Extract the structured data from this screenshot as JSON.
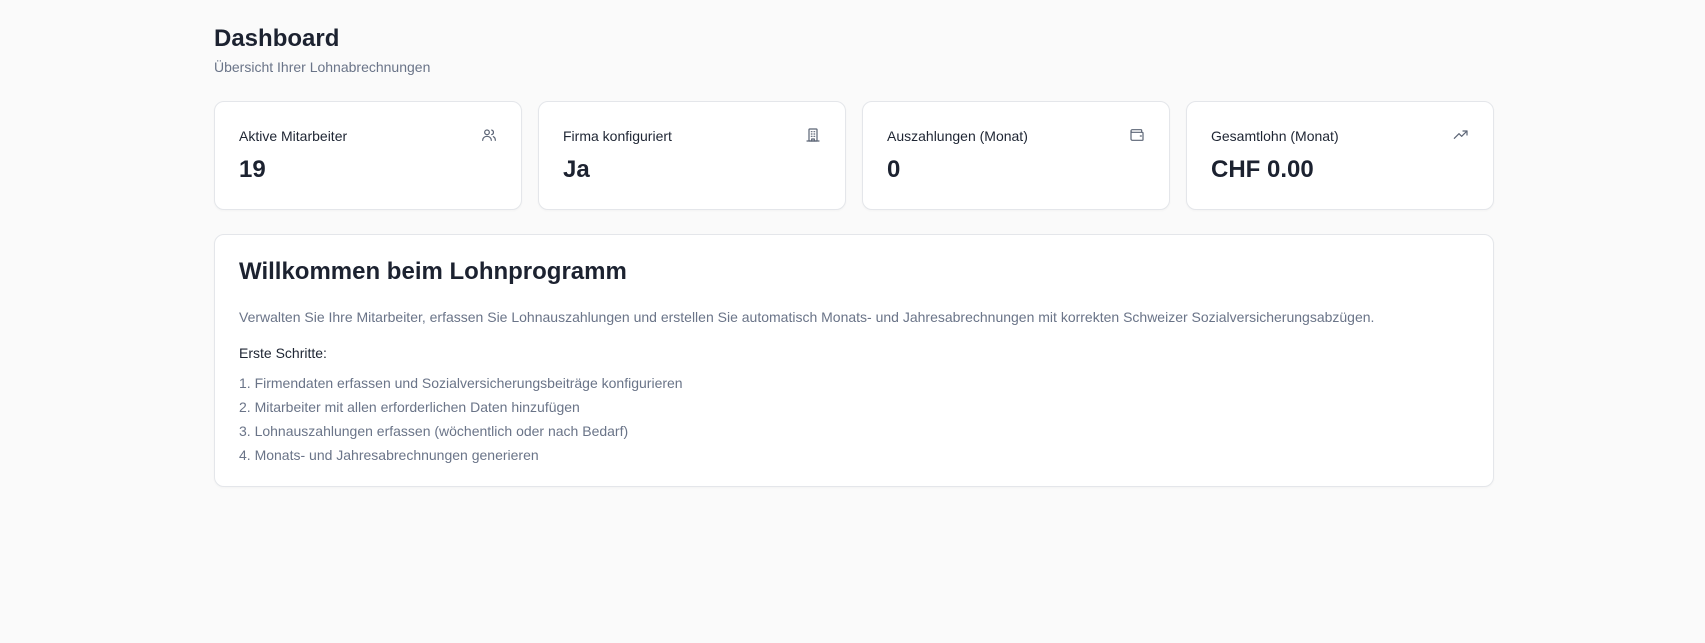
{
  "header": {
    "title": "Dashboard",
    "subtitle": "Übersicht Ihrer Lohnabrechnungen"
  },
  "stats": [
    {
      "label": "Aktive Mitarbeiter",
      "value": "19",
      "icon": "users-icon"
    },
    {
      "label": "Firma konfiguriert",
      "value": "Ja",
      "icon": "building-icon"
    },
    {
      "label": "Auszahlungen (Monat)",
      "value": "0",
      "icon": "wallet-icon"
    },
    {
      "label": "Gesamtlohn (Monat)",
      "value": "CHF 0.00",
      "icon": "trending-up-icon"
    }
  ],
  "welcome": {
    "title": "Willkommen beim Lohnprogramm",
    "description": "Verwalten Sie Ihre Mitarbeiter, erfassen Sie Lohnauszahlungen und erstellen Sie automatisch Monats- und Jahresabrechnungen mit korrekten Schweizer Sozialversicherungsabzügen.",
    "steps_heading": "Erste Schritte:",
    "steps": [
      "1. Firmendaten erfassen und Sozialversicherungsbeiträge konfigurieren",
      "2. Mitarbeiter mit allen erforderlichen Daten hinzufügen",
      "3. Lohnauszahlungen erfassen (wöchentlich oder nach Bedarf)",
      "4. Monats- und Jahresabrechnungen generieren"
    ]
  },
  "colors": {
    "background": "#fafafa",
    "card": "#ffffff",
    "border": "#e4e6ea",
    "text": "#1c2230",
    "muted": "#6a7488"
  }
}
